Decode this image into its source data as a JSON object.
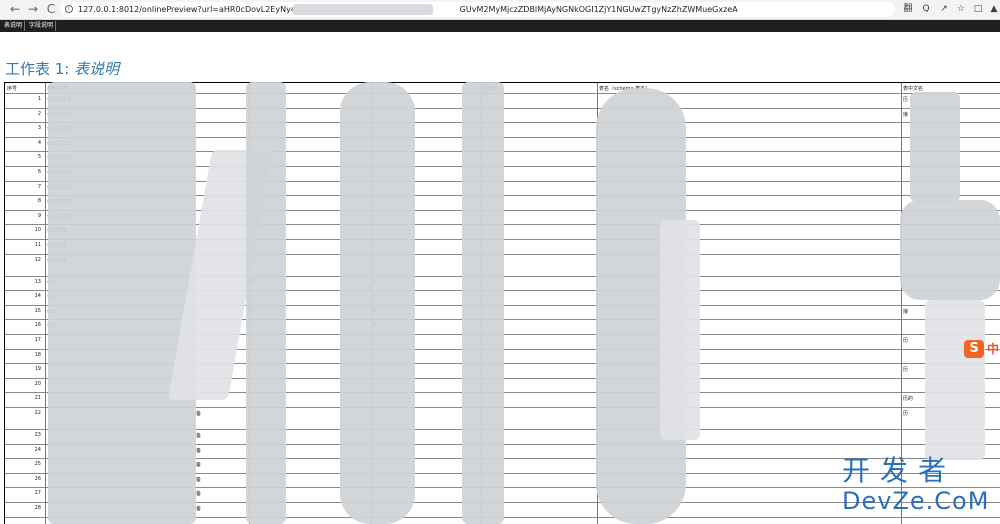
{
  "browser": {
    "back_icon": "←",
    "forward_icon": "→",
    "reload_icon": "C",
    "info_icon": "i",
    "url": "127.0.0.1:8012/onlinePreview?url=aHR0cDovL2EyNy4wLjAu",
    "url_tail": "GUvM2MyMjczZDBlMjAyNGNkOGI1ZjY1NGUwZTgyNzZhZWMueGxzeA",
    "right_icons": [
      "翻",
      "Q",
      "↗",
      "☆",
      "□",
      "▲"
    ]
  },
  "sheet_tabs": [
    "表说明",
    "字段说明"
  ],
  "sheet": {
    "title_prefix": "工作表 1: ",
    "title_name": "表说明",
    "headers": [
      "序号",
      "系统名称",
      "",
      "",
      "存储库",
      "表名（schema.表名）",
      "表中文名"
    ],
    "rows": [
      {
        "no": "1",
        "name": "公安共享平",
        "c6": "历"
      },
      {
        "no": "2",
        "name": "公安共享交",
        "c6": "接"
      },
      {
        "no": "3",
        "name": "公安共享交"
      },
      {
        "no": "4",
        "name": "公安共享交"
      },
      {
        "no": "5",
        "name": "公安共享交"
      },
      {
        "no": "6",
        "name": "公安共享交",
        "c2": "0"
      },
      {
        "no": "7",
        "name": "公安共享交",
        "c2": "0"
      },
      {
        "no": "8",
        "name": "公安共享交",
        "c2": "0"
      },
      {
        "no": "9",
        "name": "公安共享交",
        "c2": "0"
      },
      {
        "no": "10",
        "name": "公安共享",
        "c2": "0"
      },
      {
        "no": "11",
        "name": "公安共享",
        "c2": "0"
      },
      {
        "no": "12",
        "name": "公安共享",
        "c2": "0"
      },
      {
        "no": "13",
        "name": "公安",
        "c2": "0",
        "c3": "0"
      },
      {
        "no": "14",
        "name": "公安",
        "c2": "0",
        "c3": "0"
      },
      {
        "no": "15",
        "name": "公安",
        "c2": "0",
        "c3": "0",
        "c6": "接"
      },
      {
        "no": "16",
        "name": "公安",
        "c2": "0",
        "c3": "0"
      },
      {
        "no": "17",
        "name": "",
        "c2": "0",
        "c6": "历"
      },
      {
        "no": "18",
        "name": ""
      },
      {
        "no": "19",
        "name": "",
        "c6": "历"
      },
      {
        "no": "20",
        "name": ""
      },
      {
        "no": "21",
        "name": "",
        "c6": "历的"
      },
      {
        "no": "22",
        "name": "",
        "c1": "备",
        "c6": "历"
      },
      {
        "no": "23",
        "name": "",
        "c1": "备",
        "c3": "1"
      },
      {
        "no": "24",
        "name": "",
        "c1": "备",
        "c3": "1"
      },
      {
        "no": "25",
        "name": "",
        "c1": "备",
        "c3": "1"
      },
      {
        "no": "26",
        "name": "",
        "c1": "备",
        "c3": "1"
      },
      {
        "no": "27",
        "name": "",
        "c1": "备",
        "c3": "1"
      },
      {
        "no": "28",
        "name": "",
        "c1": "备",
        "c3": "1"
      }
    ]
  },
  "watermarks": {
    "ime_badge": "S",
    "ime_text": "中",
    "site_cn": "开发者",
    "site_en": "DevZe.CoM"
  }
}
